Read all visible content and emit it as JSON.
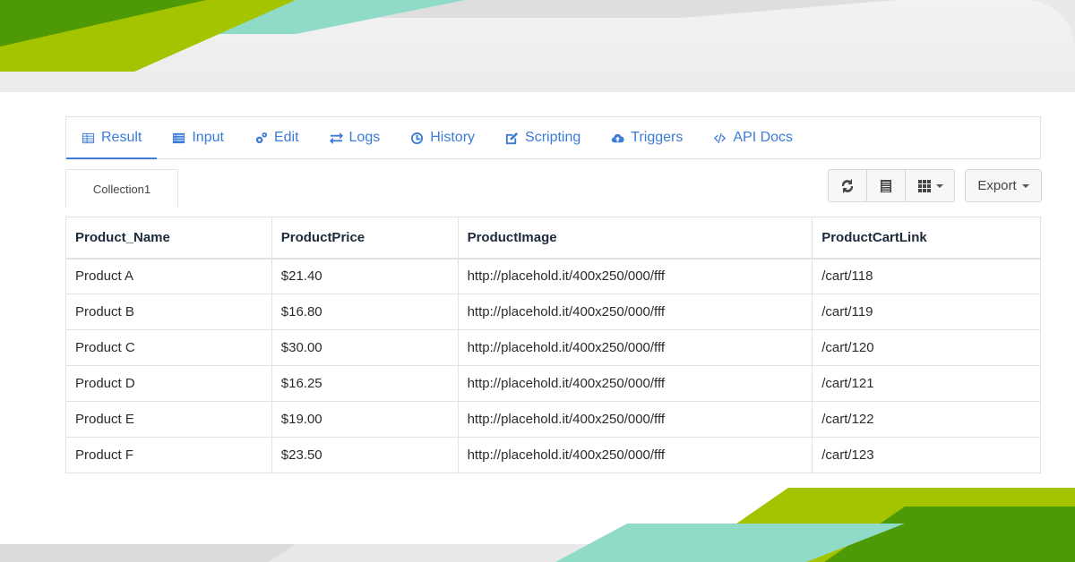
{
  "colors": {
    "accent": "#3c7bd6",
    "green_dark": "#4e9a06",
    "green_light": "#a4c400",
    "teal": "#8fdbc8"
  },
  "nav": {
    "tabs": [
      {
        "label": "Result",
        "icon": "table-icon",
        "active": true
      },
      {
        "label": "Input",
        "icon": "list-icon"
      },
      {
        "label": "Edit",
        "icon": "gears-icon"
      },
      {
        "label": "Logs",
        "icon": "exchange-icon"
      },
      {
        "label": "History",
        "icon": "clock-icon"
      },
      {
        "label": "Scripting",
        "icon": "pencil-square-icon"
      },
      {
        "label": "Triggers",
        "icon": "cloud-upload-icon"
      },
      {
        "label": "API Docs",
        "icon": "code-icon"
      }
    ]
  },
  "collection_tab": "Collection1",
  "toolbar": {
    "refresh_icon": "refresh-icon",
    "list_icon": "list-view-icon",
    "grid_icon": "grid-icon",
    "export_label": "Export"
  },
  "table": {
    "headers": [
      "Product_Name",
      "ProductPrice",
      "ProductImage",
      "ProductCartLink"
    ],
    "rows": [
      [
        "Product A",
        "$21.40",
        "http://placehold.it/400x250/000/fff",
        "/cart/118"
      ],
      [
        "Product B",
        "$16.80",
        "http://placehold.it/400x250/000/fff",
        "/cart/119"
      ],
      [
        "Product C",
        "$30.00",
        "http://placehold.it/400x250/000/fff",
        "/cart/120"
      ],
      [
        "Product D",
        "$16.25",
        "http://placehold.it/400x250/000/fff",
        "/cart/121"
      ],
      [
        "Product E",
        "$19.00",
        "http://placehold.it/400x250/000/fff",
        "/cart/122"
      ],
      [
        "Product F",
        "$23.50",
        "http://placehold.it/400x250/000/fff",
        "/cart/123"
      ]
    ]
  }
}
